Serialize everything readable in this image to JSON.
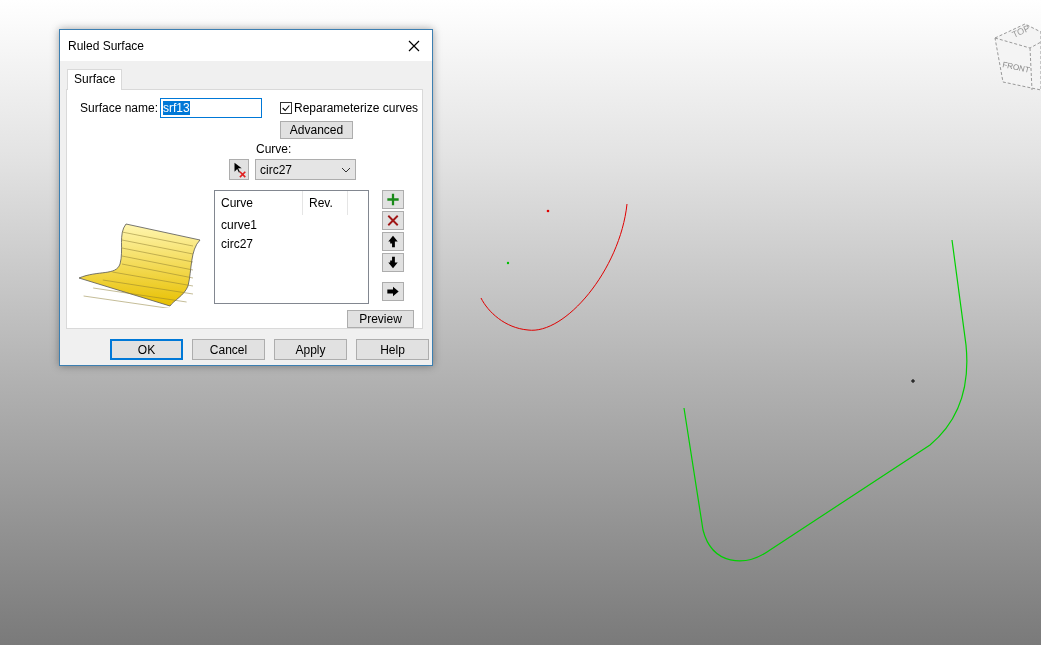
{
  "window": {
    "title": "Ruled Surface"
  },
  "tabs": [
    {
      "label": "Surface",
      "selected": true
    }
  ],
  "surface_name": {
    "label": "Surface name:",
    "value": "srf13",
    "text_selected": true
  },
  "reparameterize": {
    "label": "Reparameterize curves",
    "checked": true
  },
  "advanced_button": "Advanced",
  "curve": {
    "label": "Curve:",
    "value": "circ27"
  },
  "curve_list": {
    "columns": [
      "Curve",
      "Rev."
    ],
    "rows": [
      {
        "name": "curve1"
      },
      {
        "name": "circ27"
      }
    ]
  },
  "list_buttons": [
    {
      "kind": "add"
    },
    {
      "kind": "remove"
    },
    {
      "kind": "up"
    },
    {
      "kind": "down"
    },
    {
      "kind": "right"
    }
  ],
  "preview_button": "Preview",
  "dialog_buttons": [
    {
      "label": "OK",
      "default": true
    },
    {
      "label": "Cancel",
      "default": false
    },
    {
      "label": "Apply",
      "default": false
    },
    {
      "label": "Help",
      "default": false
    }
  ],
  "view_cube": {
    "front": "FRONT",
    "top": "TOP"
  }
}
